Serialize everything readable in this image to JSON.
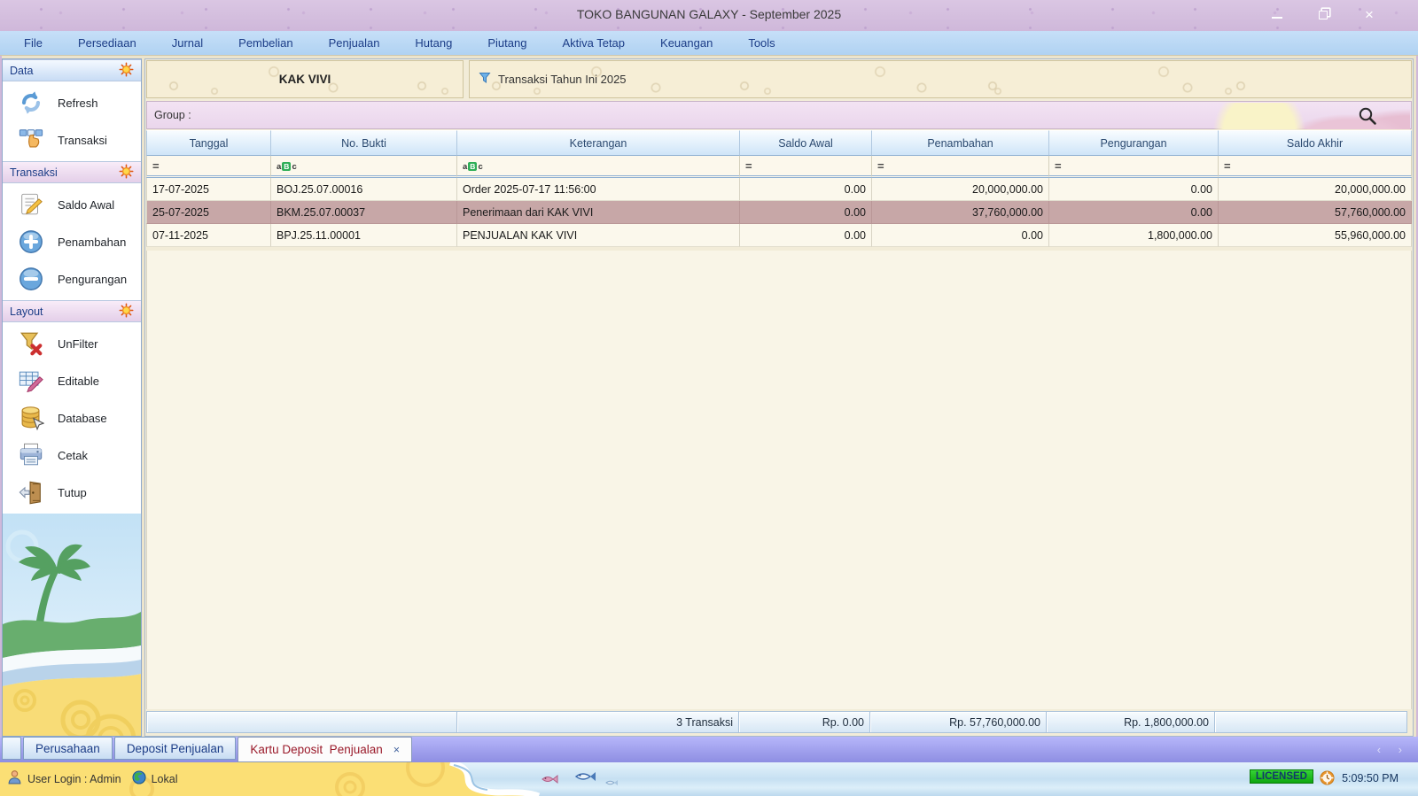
{
  "window": {
    "title": "TOKO BANGUNAN GALAXY - September 2025"
  },
  "menu": {
    "items": [
      "File",
      "Persediaan",
      "Jurnal",
      "Pembelian",
      "Penjualan",
      "Hutang",
      "Piutang",
      "Aktiva Tetap",
      "Keuangan",
      "Tools"
    ]
  },
  "sidebar": {
    "sections": [
      {
        "title": "Data",
        "tint": "blue",
        "items": [
          {
            "icon": "refresh-icon",
            "label": "Refresh"
          },
          {
            "icon": "transaksi-icon",
            "label": "Transaksi"
          }
        ]
      },
      {
        "title": "Transaksi",
        "tint": "pink",
        "items": [
          {
            "icon": "saldo-awal-icon",
            "label": "Saldo Awal"
          },
          {
            "icon": "plus-circle-icon",
            "label": "Penambahan"
          },
          {
            "icon": "minus-circle-icon",
            "label": "Pengurangan"
          }
        ]
      },
      {
        "title": "Layout",
        "tint": "pink",
        "items": [
          {
            "icon": "unfilter-icon",
            "label": "UnFilter"
          },
          {
            "icon": "editable-icon",
            "label": "Editable"
          },
          {
            "icon": "database-icon",
            "label": "Database"
          },
          {
            "icon": "printer-icon",
            "label": "Cetak"
          },
          {
            "icon": "door-exit-icon",
            "label": "Tutup"
          }
        ]
      }
    ]
  },
  "panel": {
    "title": "KAK VIVI",
    "filter_label": "Transaksi Tahun Ini 2025",
    "group_label": "Group :"
  },
  "grid": {
    "columns": [
      {
        "label": "Tanggal",
        "filter": "eq",
        "align": "left"
      },
      {
        "label": "No. Bukti",
        "filter": "abc",
        "align": "left"
      },
      {
        "label": "Keterangan",
        "filter": "abc",
        "align": "left"
      },
      {
        "label": "Saldo Awal",
        "filter": "eq",
        "align": "right"
      },
      {
        "label": "Penambahan",
        "filter": "eq",
        "align": "right"
      },
      {
        "label": "Pengurangan",
        "filter": "eq",
        "align": "right"
      },
      {
        "label": "Saldo Akhir",
        "filter": "eq",
        "align": "right"
      }
    ],
    "rows": [
      [
        "17-07-2025",
        "BOJ.25.07.00016",
        "Order 2025-07-17 11:56:00",
        "0.00",
        "20,000,000.00",
        "0.00",
        "20,000,000.00"
      ],
      [
        "25-07-2025",
        "BKM.25.07.00037",
        "Penerimaan dari KAK VIVI",
        "0.00",
        "37,760,000.00",
        "0.00",
        "57,760,000.00"
      ],
      [
        "07-11-2025",
        "BPJ.25.11.00001",
        "PENJUALAN KAK VIVI",
        "0.00",
        "0.00",
        "1,800,000.00",
        "55,960,000.00"
      ]
    ],
    "highlighted_row": 1,
    "footer": [
      "",
      "3 Transaksi",
      "Rp. 0.00",
      "Rp. 57,760,000.00",
      "Rp. 1,800,000.00",
      ""
    ]
  },
  "tabs": {
    "inactive": [
      "Perusahaan",
      "Deposit Penjualan"
    ],
    "active": "Kartu Deposit  Penjualan",
    "close_glyph": "×"
  },
  "status": {
    "user": "User Login : Admin",
    "connection": "Lokal",
    "license": "LICENSED",
    "time": "5:09:50 PM"
  }
}
